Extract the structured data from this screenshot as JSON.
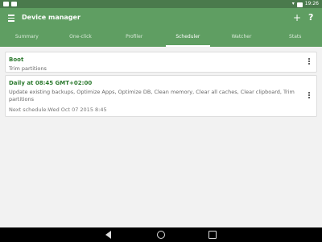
{
  "status_bar": {
    "time": "19:26"
  },
  "app_bar": {
    "title": "Device manager",
    "add_symbol": "+",
    "help_symbol": "?"
  },
  "tabs": [
    {
      "label": "Summary"
    },
    {
      "label": "One-click"
    },
    {
      "label": "Profiler"
    },
    {
      "label": "Scheduler",
      "active": true
    },
    {
      "label": "Watcher"
    },
    {
      "label": "Stats"
    }
  ],
  "schedules": [
    {
      "title": "Boot",
      "description": "Trim partitions"
    },
    {
      "title": "Daily at 08:45 GMT+02:00",
      "description": "Update existing backups, Optimize Apps, Optimize DB, Clean memory, Clear all caches, Clear clipboard, Trim partitions",
      "next": "Next schedule:Wed Oct 07 2015 8:45"
    }
  ],
  "colors": {
    "primary": "#5f9e62",
    "status_bar": "#4a7a4c",
    "accent_text": "#2c7a2f"
  }
}
